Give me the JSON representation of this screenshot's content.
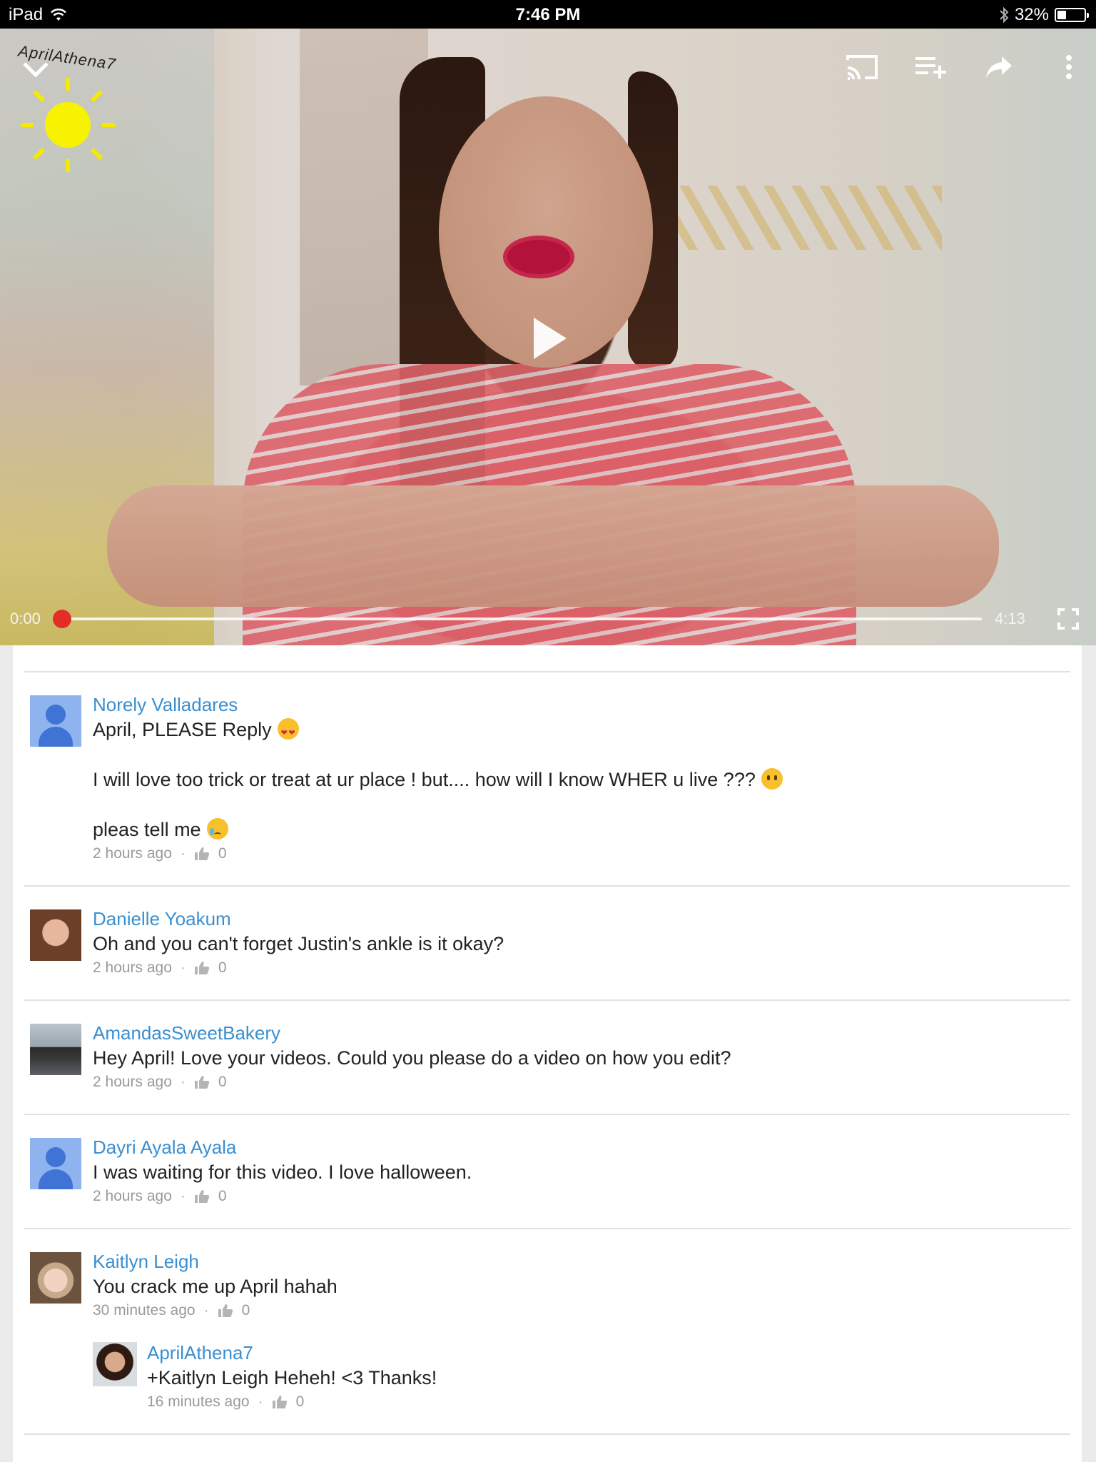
{
  "status_bar": {
    "device": "iPad",
    "time": "7:46 PM",
    "battery": "32%",
    "battery_level": 0.32
  },
  "player": {
    "watermark": "AprilAthena7",
    "current_time": "0:00",
    "total_time": "4:13",
    "progress": 0,
    "icons": {
      "collapse": "chevron-down-icon",
      "cast": "cast-icon",
      "add_to": "add-to-playlist-icon",
      "share": "share-icon",
      "more": "more-vert-icon",
      "play": "play-icon",
      "fullscreen": "fullscreen-icon"
    }
  },
  "comments": [
    {
      "author": "Norely Valladares",
      "avatar": "default",
      "lines": [
        "April, PLEASE Reply",
        "I will love too trick or treat at ur place ! but....    how will I know WHER u live ???",
        "pleas tell me"
      ],
      "time": "2 hours ago",
      "likes": "0"
    },
    {
      "author": "Danielle Yoakum",
      "avatar": "photo",
      "text": "Oh and you can't forget Justin's ankle is it okay?",
      "time": "2 hours ago",
      "likes": "0"
    },
    {
      "author": "AmandasSweetBakery",
      "avatar": "photo",
      "text": "Hey April! Love your videos. Could you please do a video on how you edit?",
      "time": "2 hours ago",
      "likes": "0"
    },
    {
      "author": "Dayri Ayala Ayala",
      "avatar": "default",
      "text": "I was waiting for this video. I love halloween.",
      "time": "2 hours ago",
      "likes": "0"
    },
    {
      "author": "Kaitlyn Leigh",
      "avatar": "photo",
      "text": "You crack me up April hahah",
      "time": "30 minutes ago",
      "likes": "0",
      "reply": {
        "author": "AprilAthena7",
        "text": "+Kaitlyn Leigh Heheh! <3 Thanks!",
        "time": "16 minutes ago",
        "likes": "0"
      }
    }
  ],
  "colors": {
    "author_link": "#3b8fd0",
    "progress_red": "#e52d27",
    "default_avatar_bg": "#8fb3ee"
  }
}
